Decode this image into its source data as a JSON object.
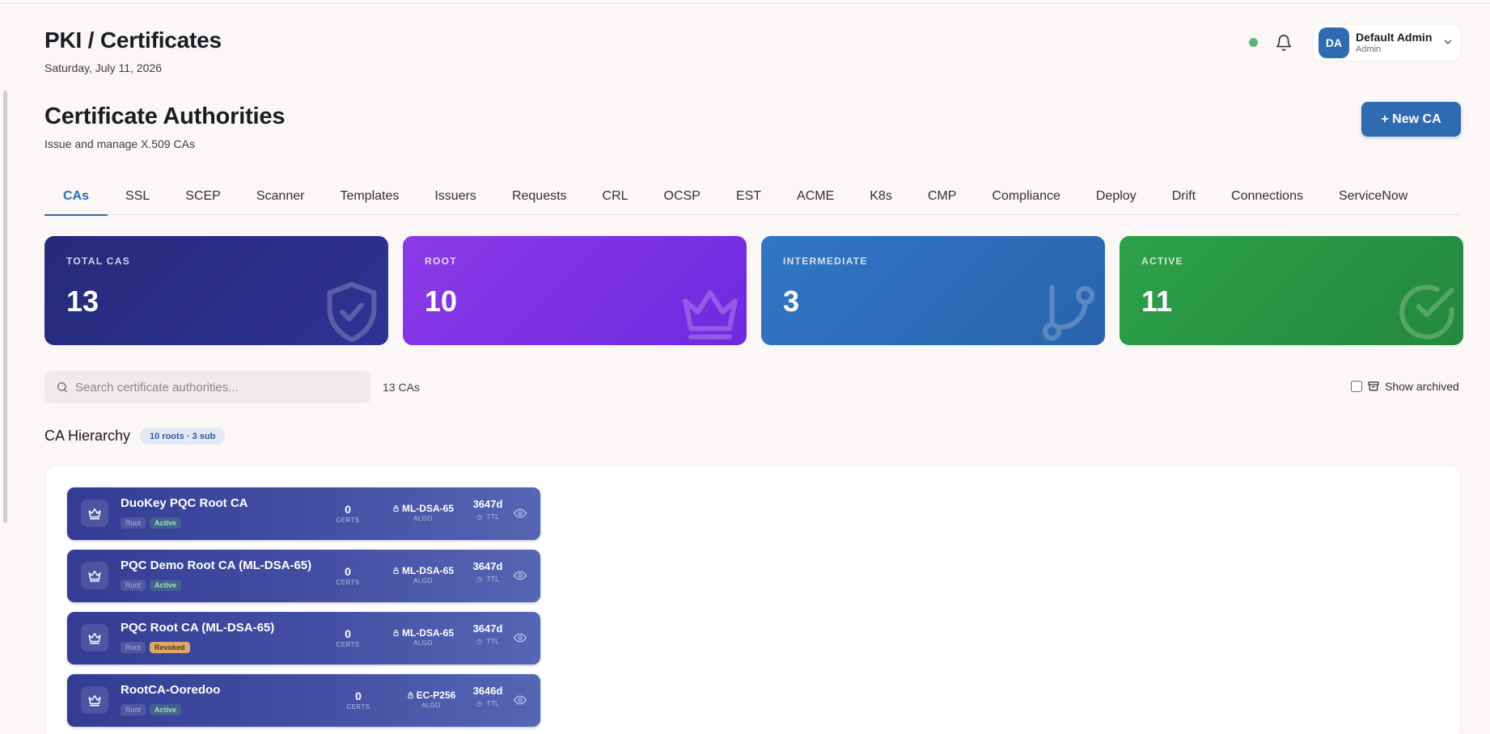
{
  "header": {
    "title": "PKI / Certificates",
    "date": "Saturday, July 11, 2026",
    "status_color": "#5cb37a",
    "user": {
      "initials": "DA",
      "name": "Default Admin",
      "role": "Admin"
    }
  },
  "section": {
    "title": "Certificate Authorities",
    "subtitle": "Issue and manage X.509 CAs",
    "new_button_label": "+ New CA"
  },
  "tabs": [
    {
      "label": "CAs",
      "active": true
    },
    {
      "label": "SSL"
    },
    {
      "label": "SCEP"
    },
    {
      "label": "Scanner"
    },
    {
      "label": "Templates"
    },
    {
      "label": "Issuers"
    },
    {
      "label": "Requests"
    },
    {
      "label": "CRL"
    },
    {
      "label": "OCSP"
    },
    {
      "label": "EST"
    },
    {
      "label": "ACME"
    },
    {
      "label": "K8s"
    },
    {
      "label": "CMP"
    },
    {
      "label": "Compliance"
    },
    {
      "label": "Deploy"
    },
    {
      "label": "Drift"
    },
    {
      "label": "Connections"
    },
    {
      "label": "ServiceNow"
    }
  ],
  "stats": [
    {
      "label": "TOTAL CAS",
      "value": "13",
      "icon": "shield-check-icon",
      "color": "#252a7a"
    },
    {
      "label": "ROOT",
      "value": "10",
      "icon": "crown-icon",
      "color": "#7b30e4"
    },
    {
      "label": "INTERMEDIATE",
      "value": "3",
      "icon": "git-branch-icon",
      "color": "#2f6fbe"
    },
    {
      "label": "ACTIVE",
      "value": "11",
      "icon": "check-circle-icon",
      "color": "#2a9845"
    }
  ],
  "search": {
    "placeholder": "Search certificate authorities...",
    "value": ""
  },
  "ca_count": "13 CAs",
  "show_archived_label": "Show archived",
  "hierarchy": {
    "title": "CA Hierarchy",
    "badge": "10 roots · 3 sub",
    "rows": [
      {
        "name": "DuoKey PQC Root CA",
        "type": "Root",
        "status": "Active",
        "certs": "0",
        "certs_label": "CERTS",
        "algo": "ML-DSA-65",
        "algo_label": "ALGO",
        "ttl": "3647d",
        "ttl_label": "TTL"
      },
      {
        "name": "PQC Demo Root CA (ML-DSA-65)",
        "type": "Root",
        "status": "Active",
        "certs": "0",
        "certs_label": "CERTS",
        "algo": "ML-DSA-65",
        "algo_label": "ALGO",
        "ttl": "3647d",
        "ttl_label": "TTL"
      },
      {
        "name": "PQC Root CA (ML-DSA-65)",
        "type": "Root",
        "status": "Revoked",
        "certs": "0",
        "certs_label": "CERTS",
        "algo": "ML-DSA-65",
        "algo_label": "ALGO",
        "ttl": "3647d",
        "ttl_label": "TTL"
      },
      {
        "name": "RootCA-Ooredoo",
        "type": "Root",
        "status": "Active",
        "certs": "0",
        "certs_label": "CERTS",
        "algo": "EC-P256",
        "algo_label": "ALGO",
        "ttl": "3646d",
        "ttl_label": "TTL"
      }
    ]
  }
}
